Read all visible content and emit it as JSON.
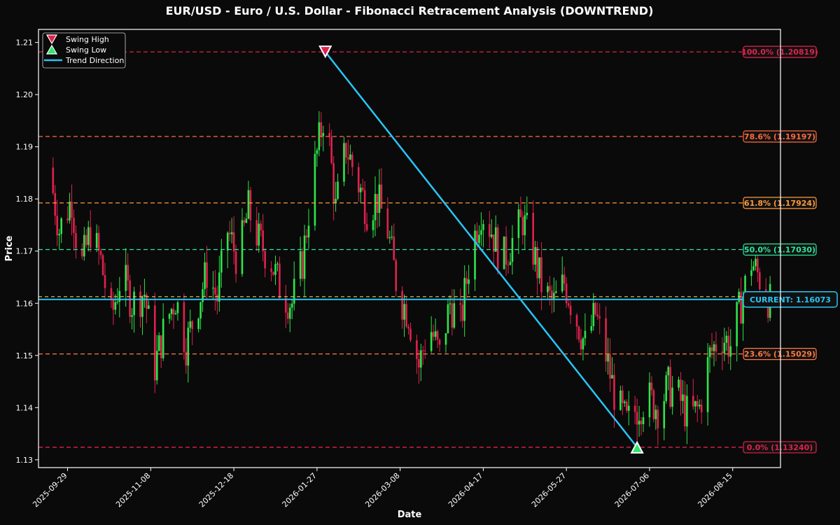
{
  "chart_data": {
    "type": "candlestick",
    "title": "EUR/USD - Euro / U.S. Dollar - Fibonacci Retracement Analysis (DOWNTREND)",
    "xlabel": "Date",
    "ylabel": "Price",
    "ylim": [
      1.1285,
      1.2125
    ],
    "xlim": [
      "2025-09-15",
      "2026-09-07"
    ],
    "x_ticks": [
      "2025-09-29",
      "2025-11-08",
      "2025-12-18",
      "2026-01-27",
      "2026-03-08",
      "2026-04-17",
      "2026-05-27",
      "2026-07-06",
      "2026-08-15"
    ],
    "y_ticks": [
      1.13,
      1.14,
      1.15,
      1.16,
      1.17,
      1.18,
      1.19,
      1.2,
      1.21
    ],
    "fib_levels": [
      {
        "label": "100.0% (1.20819)",
        "value": 1.20819,
        "color": "#e0224d"
      },
      {
        "label": "78.6% (1.19197)",
        "value": 1.19197,
        "color": "#ff6a3d"
      },
      {
        "label": "61.8% (1.17924)",
        "value": 1.17924,
        "color": "#ff9a3c"
      },
      {
        "label": "50.0% (1.17030)",
        "value": 1.1703,
        "color": "#2ee59d"
      },
      {
        "label": "23.6% (1.15029)",
        "value": 1.15029,
        "color": "#ff7a45"
      },
      {
        "label": "0.0% (1.13240)",
        "value": 1.1324,
        "color": "#e0224d"
      }
    ],
    "current": {
      "label": "CURRENT: 1.16073",
      "value": 1.16073,
      "color": "#29c5f6"
    },
    "swing_high": {
      "date": "2026-01-31",
      "value": 1.20819
    },
    "swing_low": {
      "date": "2026-06-30",
      "value": 1.1324
    },
    "legend": [
      {
        "label": "Swing High",
        "marker": "down-triangle",
        "color": "#e0224d"
      },
      {
        "label": "Swing Low",
        "marker": "up-triangle",
        "color": "#2ee56a"
      },
      {
        "label": "Trend Direction",
        "marker": "line",
        "color": "#29c5f6"
      }
    ],
    "legend_position": "top-left",
    "grid": false,
    "candle_colors": {
      "up": "#2ee54a",
      "down": "#e0224d"
    },
    "close_series": [
      {
        "date": "2025-09-20",
        "close": 1.186
      },
      {
        "date": "2025-09-25",
        "close": 1.174
      },
      {
        "date": "2025-10-01",
        "close": 1.18
      },
      {
        "date": "2025-10-05",
        "close": 1.166
      },
      {
        "date": "2025-10-10",
        "close": 1.174
      },
      {
        "date": "2025-10-15",
        "close": 1.168
      },
      {
        "date": "2025-10-20",
        "close": 1.157
      },
      {
        "date": "2025-10-25",
        "close": 1.166
      },
      {
        "date": "2025-10-30",
        "close": 1.16
      },
      {
        "date": "2025-11-05",
        "close": 1.162
      },
      {
        "date": "2025-11-10",
        "close": 1.148
      },
      {
        "date": "2025-11-15",
        "close": 1.156
      },
      {
        "date": "2025-11-20",
        "close": 1.161
      },
      {
        "date": "2025-11-25",
        "close": 1.152
      },
      {
        "date": "2025-11-30",
        "close": 1.159
      },
      {
        "date": "2025-12-05",
        "close": 1.166
      },
      {
        "date": "2025-12-10",
        "close": 1.161
      },
      {
        "date": "2025-12-15",
        "close": 1.174
      },
      {
        "date": "2025-12-20",
        "close": 1.168
      },
      {
        "date": "2025-12-25",
        "close": 1.178
      },
      {
        "date": "2025-12-30",
        "close": 1.172
      },
      {
        "date": "2026-01-05",
        "close": 1.168
      },
      {
        "date": "2026-01-10",
        "close": 1.162
      },
      {
        "date": "2026-01-15",
        "close": 1.16
      },
      {
        "date": "2026-01-20",
        "close": 1.168
      },
      {
        "date": "2026-01-25",
        "close": 1.184
      },
      {
        "date": "2026-01-31",
        "close": 1.198
      },
      {
        "date": "2026-02-05",
        "close": 1.178
      },
      {
        "date": "2026-02-10",
        "close": 1.19
      },
      {
        "date": "2026-02-15",
        "close": 1.184
      },
      {
        "date": "2026-02-20",
        "close": 1.178
      },
      {
        "date": "2026-02-25",
        "close": 1.18
      },
      {
        "date": "2026-03-02",
        "close": 1.174
      },
      {
        "date": "2026-03-07",
        "close": 1.162
      },
      {
        "date": "2026-03-12",
        "close": 1.158
      },
      {
        "date": "2026-03-17",
        "close": 1.148
      },
      {
        "date": "2026-03-22",
        "close": 1.156
      },
      {
        "date": "2026-03-27",
        "close": 1.15
      },
      {
        "date": "2026-04-01",
        "close": 1.16
      },
      {
        "date": "2026-04-06",
        "close": 1.156
      },
      {
        "date": "2026-04-11",
        "close": 1.17
      },
      {
        "date": "2026-04-16",
        "close": 1.178
      },
      {
        "date": "2026-04-21",
        "close": 1.174
      },
      {
        "date": "2026-04-26",
        "close": 1.168
      },
      {
        "date": "2026-05-01",
        "close": 1.172
      },
      {
        "date": "2026-05-06",
        "close": 1.176
      },
      {
        "date": "2026-05-11",
        "close": 1.17
      },
      {
        "date": "2026-05-16",
        "close": 1.162
      },
      {
        "date": "2026-05-21",
        "close": 1.16
      },
      {
        "date": "2026-05-26",
        "close": 1.164
      },
      {
        "date": "2026-05-31",
        "close": 1.158
      },
      {
        "date": "2026-06-05",
        "close": 1.152
      },
      {
        "date": "2026-06-10",
        "close": 1.158
      },
      {
        "date": "2026-06-15",
        "close": 1.15
      },
      {
        "date": "2026-06-20",
        "close": 1.141
      },
      {
        "date": "2026-06-25",
        "close": 1.137
      },
      {
        "date": "2026-06-30",
        "close": 1.14
      },
      {
        "date": "2026-07-05",
        "close": 1.142
      },
      {
        "date": "2026-07-10",
        "close": 1.14
      },
      {
        "date": "2026-07-15",
        "close": 1.144
      },
      {
        "date": "2026-07-20",
        "close": 1.142
      },
      {
        "date": "2026-07-25",
        "close": 1.138
      },
      {
        "date": "2026-07-30",
        "close": 1.14
      },
      {
        "date": "2026-08-04",
        "close": 1.15
      },
      {
        "date": "2026-08-09",
        "close": 1.154
      },
      {
        "date": "2026-08-14",
        "close": 1.152
      },
      {
        "date": "2026-08-19",
        "close": 1.16
      },
      {
        "date": "2026-08-24",
        "close": 1.168
      },
      {
        "date": "2026-08-29",
        "close": 1.164
      },
      {
        "date": "2026-09-02",
        "close": 1.16
      }
    ]
  }
}
